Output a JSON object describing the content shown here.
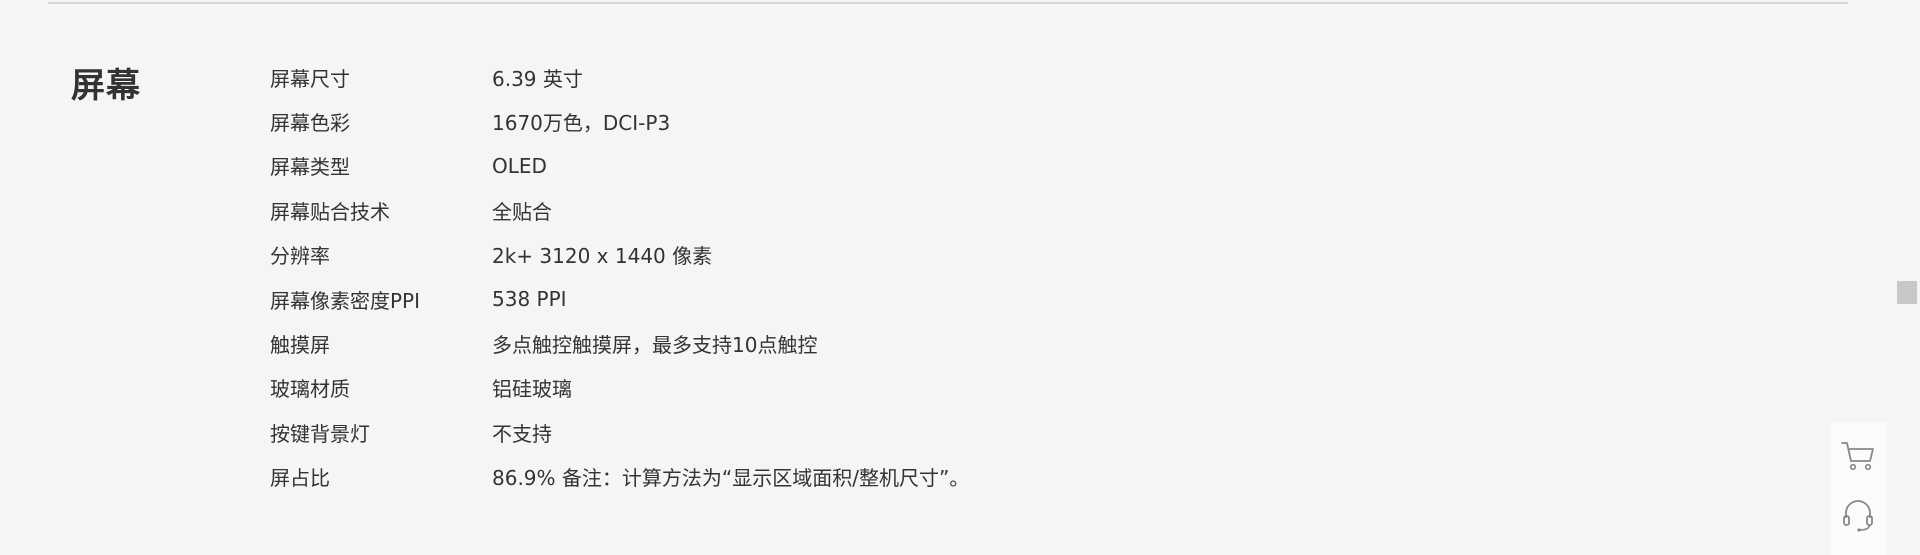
{
  "section": {
    "title": "屏幕"
  },
  "specs": [
    {
      "label": "屏幕尺寸",
      "value": "6.39 英寸"
    },
    {
      "label": "屏幕色彩",
      "value": "1670万色，DCI-P3"
    },
    {
      "label": "屏幕类型",
      "value": "OLED"
    },
    {
      "label": "屏幕贴合技术",
      "value": "全贴合"
    },
    {
      "label": "分辨率",
      "value": "2k+ 3120 x 1440 像素"
    },
    {
      "label": "屏幕像素密度PPI",
      "value": "538 PPI"
    },
    {
      "label": "触摸屏",
      "value": "多点触控触摸屏，最多支持10点触控"
    },
    {
      "label": "玻璃材质",
      "value": "铝硅玻璃"
    },
    {
      "label": "按键背景灯",
      "value": "不支持"
    },
    {
      "label": "屏占比",
      "value": "86.9% 备注：计算方法为“显示区域面积/整机尺寸”。"
    }
  ],
  "side_tools": {
    "cart_icon": "shopping-cart-icon",
    "service_icon": "headset-icon"
  },
  "colors": {
    "background": "#f5f5f5",
    "text": "#333333",
    "divider": "#d6d6d6",
    "icon": "#888888"
  }
}
